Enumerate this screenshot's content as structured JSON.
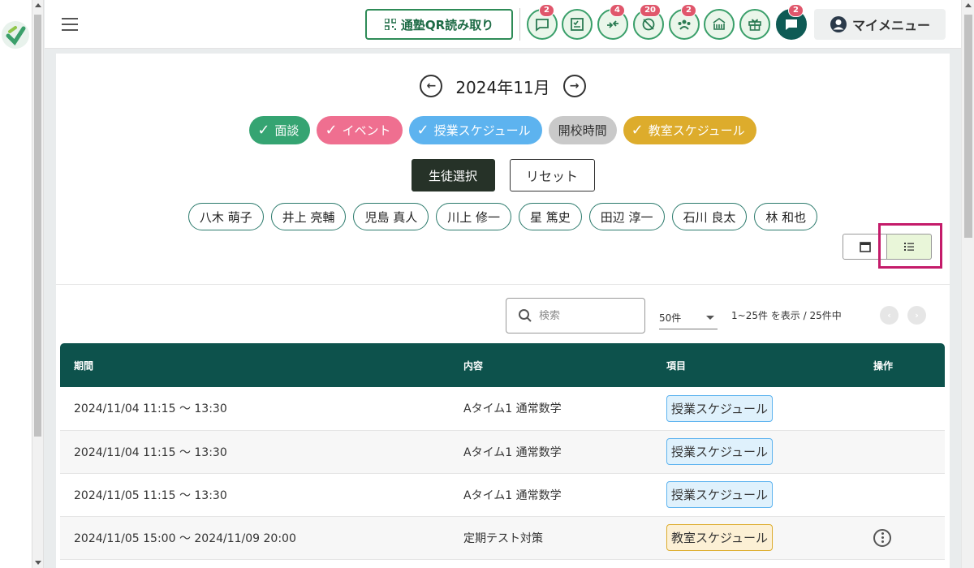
{
  "header": {
    "qr_label": "通塾QR読み取り",
    "badges": {
      "chat": "2",
      "transfer": "4",
      "absence": "20",
      "group": "2",
      "message": "2"
    },
    "mymenu_label": "マイメニュー"
  },
  "calendar": {
    "month": "2024年11月",
    "filters": [
      {
        "label": "面談",
        "checked": true,
        "color": "#35a472"
      },
      {
        "label": "イベント",
        "checked": true,
        "color": "#ef6f90"
      },
      {
        "label": "授業スケジュール",
        "checked": true,
        "color": "#5db3ef"
      },
      {
        "label": "開校時間",
        "checked": false,
        "color": "#c9c9c9"
      },
      {
        "label": "教室スケジュール",
        "checked": true,
        "color": "#ddac2c"
      }
    ],
    "select_students_label": "生徒選択",
    "reset_label": "リセット",
    "students": [
      "八木 萌子",
      "井上 亮輔",
      "児島 真人",
      "川上 修一",
      "星 篤史",
      "田辺 淳一",
      "石川 良太",
      "林 和也"
    ]
  },
  "list": {
    "search_placeholder": "検索",
    "per_page": "50件",
    "range_text": "1~25件 を表示 / 25件中",
    "columns": [
      "期間",
      "内容",
      "項目",
      "操作"
    ],
    "rows": [
      {
        "period": "2024/11/04 11:15 ～ 13:30",
        "content": "Aタイム1 通常数学",
        "category": "授業スケジュール",
        "kind": "sched",
        "has_action": false
      },
      {
        "period": "2024/11/04 11:15 ～ 13:30",
        "content": "Aタイム1 通常数学",
        "category": "授業スケジュール",
        "kind": "sched",
        "has_action": false
      },
      {
        "period": "2024/11/05 11:15 ～ 13:30",
        "content": "Aタイム1 通常数学",
        "category": "授業スケジュール",
        "kind": "sched",
        "has_action": false
      },
      {
        "period": "2024/11/05 15:00 ～ 2024/11/09 20:00",
        "content": "定期テスト対策",
        "category": "教室スケジュール",
        "kind": "room",
        "has_action": true
      }
    ]
  }
}
